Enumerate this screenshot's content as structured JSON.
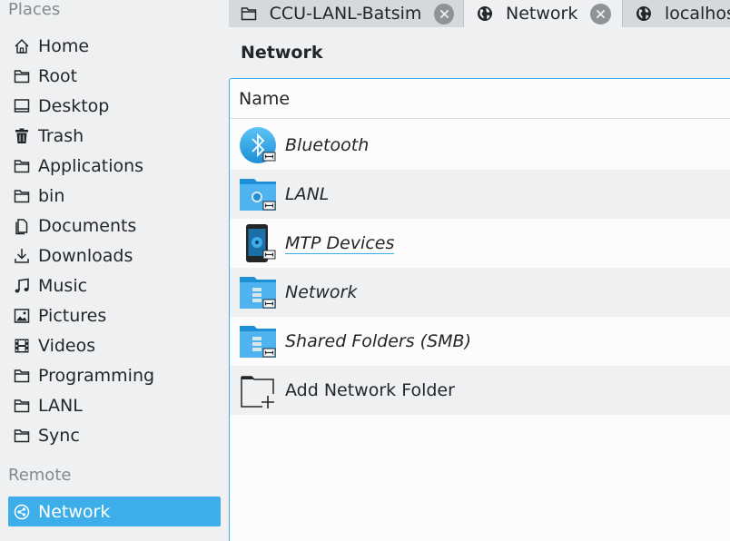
{
  "sidebar": {
    "places_title": "Places",
    "remote_title": "Remote",
    "places": [
      {
        "label": "Home",
        "icon": "home-icon"
      },
      {
        "label": "Root",
        "icon": "folder-icon"
      },
      {
        "label": "Desktop",
        "icon": "desktop-icon"
      },
      {
        "label": "Trash",
        "icon": "trash-icon"
      },
      {
        "label": "Applications",
        "icon": "folder-icon"
      },
      {
        "label": "bin",
        "icon": "folder-icon"
      },
      {
        "label": "Documents",
        "icon": "documents-icon"
      },
      {
        "label": "Downloads",
        "icon": "downloads-icon"
      },
      {
        "label": "Music",
        "icon": "music-icon"
      },
      {
        "label": "Pictures",
        "icon": "pictures-icon"
      },
      {
        "label": "Videos",
        "icon": "videos-icon"
      },
      {
        "label": "Programming",
        "icon": "folder-icon"
      },
      {
        "label": "LANL",
        "icon": "folder-icon"
      },
      {
        "label": "Sync",
        "icon": "folder-icon"
      }
    ],
    "remote": [
      {
        "label": "Network",
        "icon": "network-icon",
        "selected": true
      }
    ]
  },
  "tabs": [
    {
      "label": "CCU-LANL-Batsim",
      "icon": "folder-icon",
      "active": false
    },
    {
      "label": "Network",
      "icon": "globe-icon",
      "active": true
    },
    {
      "label": "localhost",
      "icon": "globe-icon",
      "active": false
    }
  ],
  "location_title": "Network",
  "view": {
    "column_name": "Name",
    "items": [
      {
        "label": "Bluetooth",
        "icon": "bluetooth-icon"
      },
      {
        "label": "LANL",
        "icon": "network-folder-icon"
      },
      {
        "label": "MTP Devices",
        "icon": "mtp-device-icon"
      },
      {
        "label": "Network",
        "icon": "network-folder-icon"
      },
      {
        "label": "Shared Folders (SMB)",
        "icon": "smb-folder-icon"
      },
      {
        "label": "Add Network Folder",
        "icon": "add-folder-icon"
      }
    ]
  },
  "colors": {
    "accent": "#3daee9",
    "window_bg": "#eff0f1",
    "view_bg": "#fcfcfc",
    "text": "#232629",
    "muted": "#7f8c8d"
  }
}
